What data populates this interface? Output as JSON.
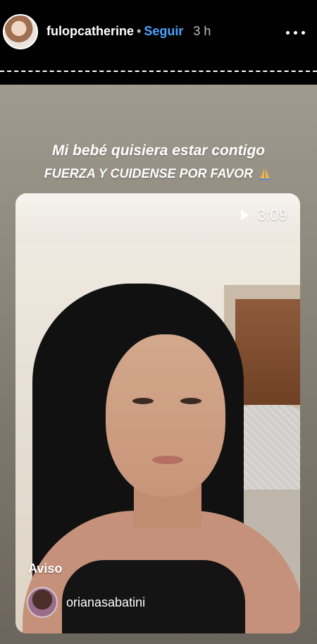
{
  "header": {
    "username": "fulopcatherine",
    "separator": "•",
    "follow_label": "Seguir",
    "time_ago": "3 h",
    "more_icon": "more-options-icon"
  },
  "story": {
    "caption_line1": "Mi bebé quisiera estar contigo",
    "caption_line2": "FUERZA Y CUIDENSE POR FAVOR",
    "emoji_icon": "praying-hands-icon",
    "video": {
      "duration": "3:09",
      "play_icon": "play-icon",
      "notice_label": "Aviso",
      "mention_username": "orianasabatini"
    }
  },
  "colors": {
    "follow_blue": "#4aa3ff",
    "background": "#000000"
  }
}
